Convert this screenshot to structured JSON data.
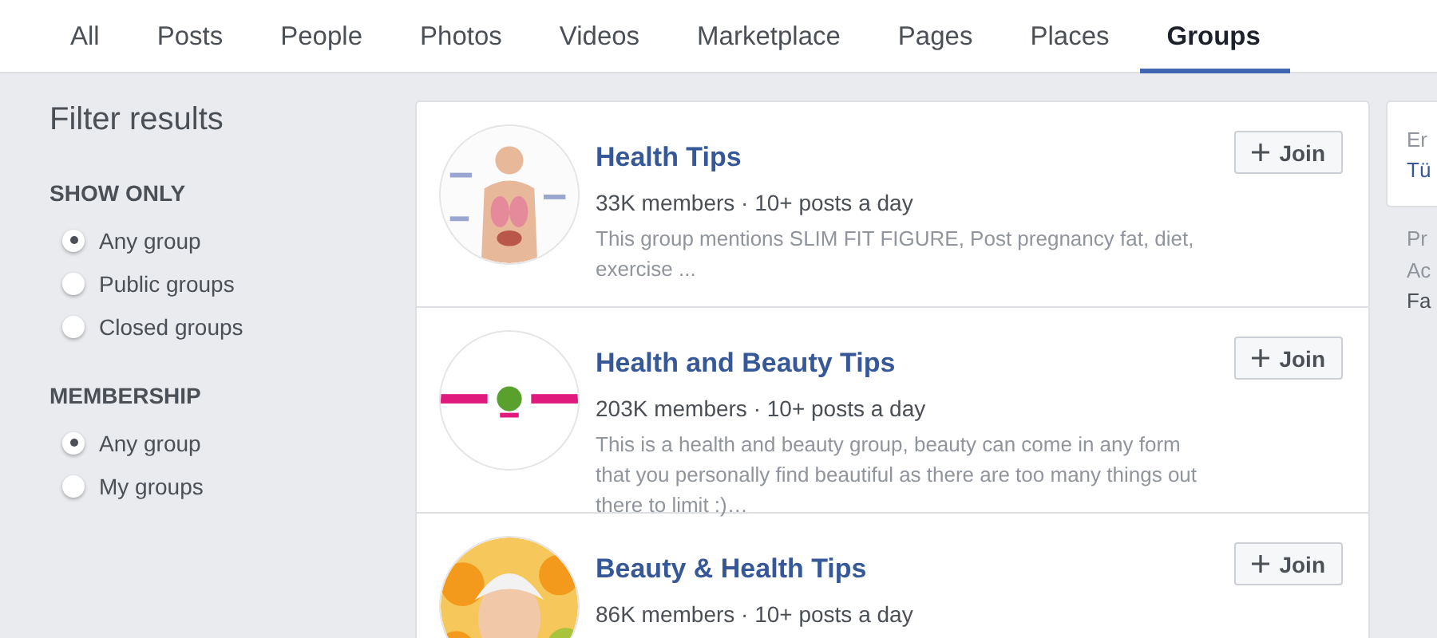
{
  "tabs": [
    {
      "label": "All",
      "selected": false
    },
    {
      "label": "Posts",
      "selected": false
    },
    {
      "label": "People",
      "selected": false
    },
    {
      "label": "Photos",
      "selected": false
    },
    {
      "label": "Videos",
      "selected": false
    },
    {
      "label": "Marketplace",
      "selected": false
    },
    {
      "label": "Pages",
      "selected": false
    },
    {
      "label": "Places",
      "selected": false
    },
    {
      "label": "Groups",
      "selected": true
    }
  ],
  "filter": {
    "title": "Filter results",
    "sections": [
      {
        "heading": "SHOW ONLY",
        "options": [
          {
            "label": "Any group",
            "selected": true
          },
          {
            "label": "Public groups",
            "selected": false
          },
          {
            "label": "Closed groups",
            "selected": false
          }
        ]
      },
      {
        "heading": "MEMBERSHIP",
        "options": [
          {
            "label": "Any group",
            "selected": true
          },
          {
            "label": "My groups",
            "selected": false
          }
        ]
      }
    ]
  },
  "results": [
    {
      "name": "Health Tips",
      "meta": "33K members · 10+ posts a day",
      "description": "This group mentions SLIM FIT FIGURE, Post pregnancy fat, diet, exercise ...",
      "button": "Join"
    },
    {
      "name": "Health and Beauty Tips",
      "meta": "203K members · 10+ posts a day",
      "description": "This is a health and beauty group, beauty can come in any form that you personally find beautiful as there are too many things out there to limit :)…",
      "button": "Join"
    },
    {
      "name": "Beauty & Health Tips",
      "meta": "86K members · 10+ posts a day",
      "button": "Join"
    }
  ],
  "side_panel": {
    "card_lines": [
      "Er",
      "Tü"
    ],
    "lines": [
      "Pr",
      "Ac",
      "Fa"
    ]
  }
}
